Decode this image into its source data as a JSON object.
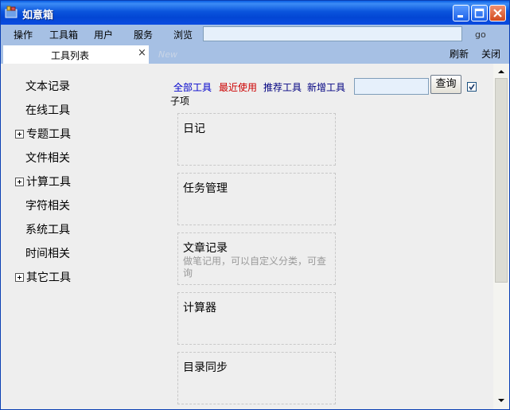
{
  "window": {
    "title": "如意箱",
    "icon": "toolbox-icon",
    "controls": [
      "minimize",
      "maximize",
      "close"
    ]
  },
  "menu": {
    "items": [
      {
        "label": "操作"
      },
      {
        "label": "工具箱"
      },
      {
        "label": "用户"
      },
      {
        "label": "服务"
      },
      {
        "label": "浏览"
      }
    ],
    "url_value": "",
    "go_label": "go"
  },
  "tabs": {
    "active": {
      "label": "工具列表",
      "close": "×"
    },
    "new_label": "New",
    "refresh_label": "刷新",
    "close_label": "关闭"
  },
  "sidebar": {
    "items": [
      {
        "label": "文本记录",
        "expandable": false
      },
      {
        "label": "在线工具",
        "expandable": false
      },
      {
        "label": "专题工具",
        "expandable": true
      },
      {
        "label": "文件相关",
        "expandable": false
      },
      {
        "label": "计算工具",
        "expandable": true
      },
      {
        "label": "字符相关",
        "expandable": false
      },
      {
        "label": "系统工具",
        "expandable": false
      },
      {
        "label": "时间相关",
        "expandable": false
      },
      {
        "label": "其它工具",
        "expandable": true
      }
    ]
  },
  "filters": {
    "links": [
      {
        "label": "全部工具",
        "color": "#0000cc"
      },
      {
        "label": "最近使用",
        "color": "#cc0000"
      },
      {
        "label": "推荐工具",
        "color": "#000080"
      },
      {
        "label": "新增工具",
        "color": "#000080"
      }
    ],
    "search_value": "",
    "search_button": "查询",
    "subitems_checked": true,
    "subitems_label": "子项"
  },
  "tools": [
    {
      "title": "日记",
      "desc": ""
    },
    {
      "title": "任务管理",
      "desc": ""
    },
    {
      "title": "文章记录",
      "desc": "做笔记用，可以自定义分类，可查询"
    },
    {
      "title": "计算器",
      "desc": ""
    },
    {
      "title": "目录同步",
      "desc": ""
    }
  ],
  "colors": {
    "titlebar": "#0a54dc",
    "menubar": "#a6c0e4",
    "content_bg": "#eeeeee"
  }
}
